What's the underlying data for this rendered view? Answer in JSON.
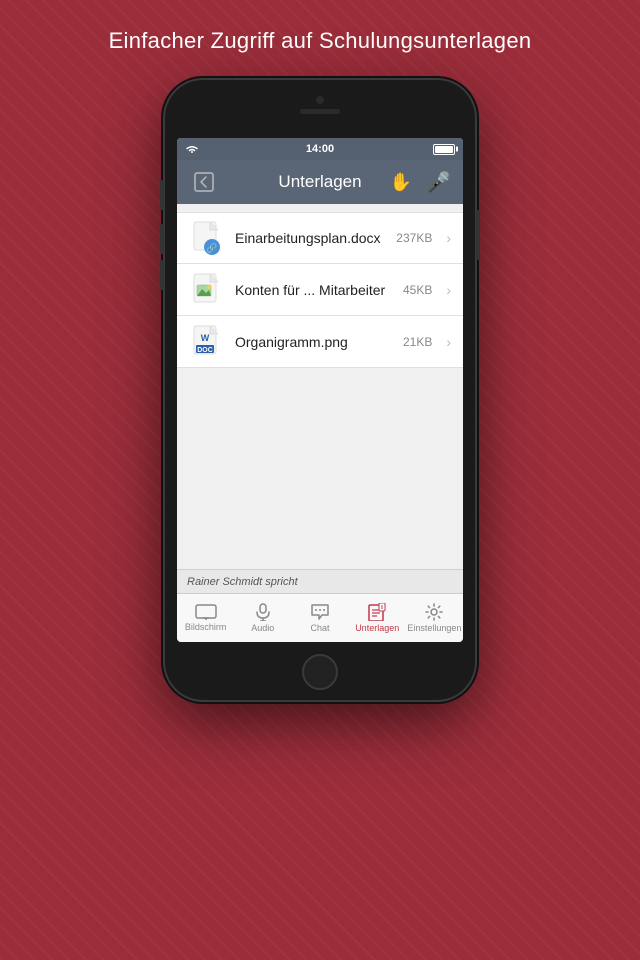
{
  "page": {
    "bg_title": "Einfacher Zugriff auf Schulungsunterlagen"
  },
  "status_bar": {
    "time": "14:00"
  },
  "nav": {
    "title": "Unterlagen"
  },
  "files": [
    {
      "name": "Einarbeitungsplan.docx",
      "size": "237KB",
      "icon_type": "docx"
    },
    {
      "name": "Konten für ... Mitarbeiter",
      "size": "45KB",
      "icon_type": "image"
    },
    {
      "name": "Organigramm.png",
      "size": "21KB",
      "icon_type": "doc"
    }
  ],
  "speaker_bar": {
    "text": "Rainer Schmidt spricht"
  },
  "tabs": [
    {
      "label": "Bildschirm",
      "icon": "monitor",
      "active": false
    },
    {
      "label": "Audio",
      "icon": "audio",
      "active": false
    },
    {
      "label": "Chat",
      "icon": "chat",
      "active": false
    },
    {
      "label": "Unterlagen",
      "icon": "docs",
      "active": true
    },
    {
      "label": "Einstellungen",
      "icon": "settings",
      "active": false
    }
  ]
}
